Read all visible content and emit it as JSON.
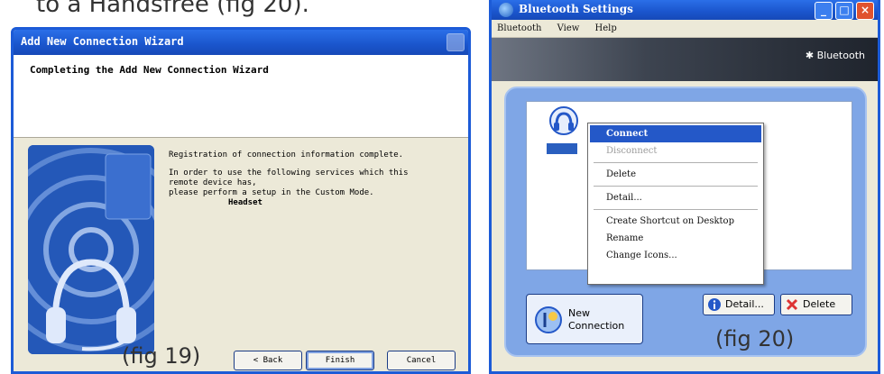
{
  "caption_top": "to a Handsfree (fig 20).",
  "fig19": {
    "title": "Add New Connection Wizard",
    "heading": "Completing the Add New Connection Wizard",
    "line1": "Registration of connection information complete.",
    "line2": "In order to use the following services which this",
    "line3": "remote device has,",
    "line4": "please perform a setup in the Custom Mode.",
    "service": "Headset",
    "label": "(fig 19)",
    "back": "< Back",
    "finish": "Finish",
    "cancel": "Cancel"
  },
  "fig20": {
    "title": "Bluetooth Settings",
    "menu": [
      "Bluetooth",
      "View",
      "Help"
    ],
    "brand": "Bluetooth",
    "context_menu": {
      "connect": "Connect",
      "disconnect": "Disconnect",
      "delete": "Delete",
      "detail": "Detail...",
      "create_shortcut": "Create Shortcut on Desktop",
      "rename": "Rename",
      "change_icons": "Change Icons..."
    },
    "new_connection_line1": "New",
    "new_connection_line2": "Connection",
    "detail_btn": "Detail...",
    "delete_btn": "Delete",
    "label": "(fig 20)"
  }
}
